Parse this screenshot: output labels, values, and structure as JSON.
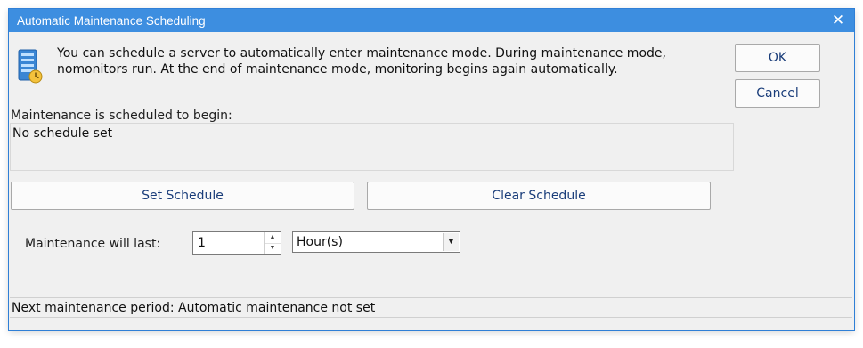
{
  "window": {
    "title": "Automatic Maintenance Scheduling",
    "close_glyph": "✕",
    "accent_color": "#3d8ee0"
  },
  "app_icon": "server-clock-icon",
  "intro_text": "You can schedule a server to automatically enter maintenance mode.  During maintenance mode, nomonitors run. At the end of maintenance mode, monitoring begins again automatically.",
  "buttons": {
    "ok": "OK",
    "cancel": "Cancel",
    "set_schedule": "Set Schedule",
    "clear_schedule": "Clear Schedule"
  },
  "schedule": {
    "label": "Maintenance is scheduled to begin:",
    "value": "No schedule set"
  },
  "duration": {
    "label": "Maintenance will last:",
    "value": "1",
    "unit_selected": "Hour(s)"
  },
  "status": {
    "text": "Next maintenance period: Automatic maintenance not set"
  }
}
